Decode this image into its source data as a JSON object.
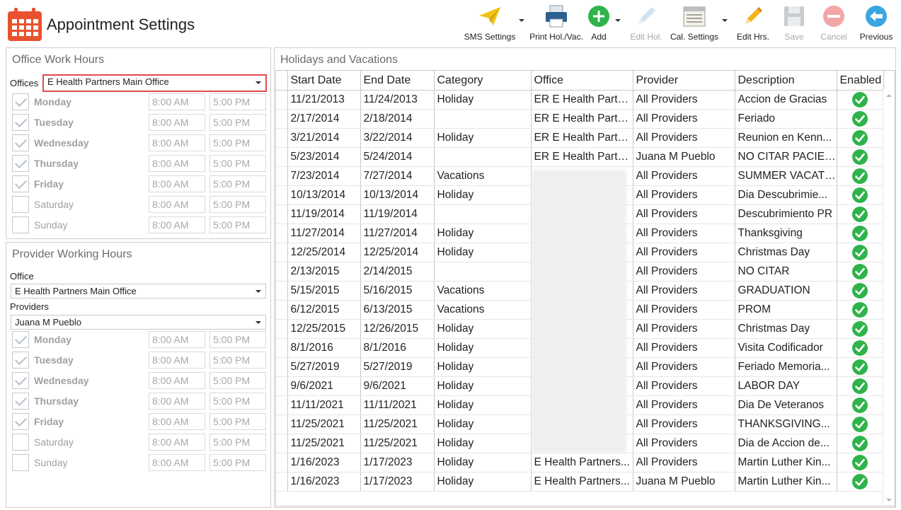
{
  "header": {
    "title": "Appointment Settings"
  },
  "toolbar": {
    "sms": "SMS Settings",
    "print": "Print Hol./Vac.",
    "add": "Add",
    "edit_hol": "Edit Hol.",
    "cal_settings": "Cal. Settings",
    "edit_hrs": "Edit Hrs.",
    "save": "Save",
    "cancel": "Cancel",
    "previous": "Previous"
  },
  "office_hours": {
    "title": "Office Work Hours",
    "offices_label": "Offices",
    "office_value": "E Health Partners Main Office",
    "days": [
      {
        "day": "Monday",
        "checked": true,
        "start": "8:00 AM",
        "end": "5:00 PM"
      },
      {
        "day": "Tuesday",
        "checked": true,
        "start": "8:00 AM",
        "end": "5:00 PM"
      },
      {
        "day": "Wednesday",
        "checked": true,
        "start": "8:00 AM",
        "end": "5:00 PM"
      },
      {
        "day": "Thursday",
        "checked": true,
        "start": "8:00 AM",
        "end": "5:00 PM"
      },
      {
        "day": "Friday",
        "checked": true,
        "start": "8:00 AM",
        "end": "5:00 PM"
      },
      {
        "day": "Saturday",
        "checked": false,
        "start": "8:00 AM",
        "end": "5:00 PM"
      },
      {
        "day": "Sunday",
        "checked": false,
        "start": "8:00 AM",
        "end": "5:00 PM"
      }
    ]
  },
  "provider_hours": {
    "title": "Provider Working Hours",
    "office_label": "Office",
    "office_value": "E Health Partners Main Office",
    "providers_label": "Providers",
    "provider_value": "Juana M Pueblo",
    "days": [
      {
        "day": "Monday",
        "checked": true,
        "start": "8:00 AM",
        "end": "5:00 PM"
      },
      {
        "day": "Tuesday",
        "checked": true,
        "start": "8:00 AM",
        "end": "5:00 PM"
      },
      {
        "day": "Wednesday",
        "checked": true,
        "start": "8:00 AM",
        "end": "5:00 PM"
      },
      {
        "day": "Thursday",
        "checked": true,
        "start": "8:00 AM",
        "end": "5:00 PM"
      },
      {
        "day": "Friday",
        "checked": true,
        "start": "8:00 AM",
        "end": "5:00 PM"
      },
      {
        "day": "Saturday",
        "checked": false,
        "start": "8:00 AM",
        "end": "5:00 PM"
      },
      {
        "day": "Sunday",
        "checked": false,
        "start": "8:00 AM",
        "end": "5:00 PM"
      }
    ]
  },
  "holidays": {
    "title": "Holidays and Vacations",
    "columns": [
      "Start Date",
      "End Date",
      "Category",
      "Office",
      "Provider",
      "Description",
      "Enabled"
    ],
    "rows": [
      [
        "11/21/2013",
        "11/24/2013",
        "Holiday",
        "ER E Health Partn...",
        "All Providers",
        "Accion de Gracias"
      ],
      [
        "2/17/2014",
        "2/18/2014",
        "",
        "ER E Health Partn...",
        "All Providers",
        "Feriado"
      ],
      [
        "3/21/2014",
        "3/22/2014",
        "Holiday",
        "ER E Health Partn...",
        "All Providers",
        "Reunion en Kenn..."
      ],
      [
        "5/23/2014",
        "5/24/2014",
        "",
        "ER E Health Partn...",
        "Juana M Pueblo",
        "NO CITAR PACIET..."
      ],
      [
        "7/23/2014",
        "7/27/2014",
        "Vacations",
        "",
        "All Providers",
        "SUMMER VACATI..."
      ],
      [
        "10/13/2014",
        "10/13/2014",
        "Holiday",
        "",
        "All Providers",
        "Dia Descubrimie..."
      ],
      [
        "11/19/2014",
        "11/19/2014",
        "",
        "",
        "All Providers",
        "Descubrimiento PR"
      ],
      [
        "11/27/2014",
        "11/27/2014",
        "Holiday",
        "",
        "All Providers",
        "Thanksgiving"
      ],
      [
        "12/25/2014",
        "12/25/2014",
        "Holiday",
        "",
        "All Providers",
        "Christmas Day"
      ],
      [
        "2/13/2015",
        "2/14/2015",
        "",
        "",
        "All Providers",
        "NO CITAR"
      ],
      [
        "5/15/2015",
        "5/16/2015",
        "Vacations",
        "",
        "All Providers",
        "GRADUATION"
      ],
      [
        "6/12/2015",
        "6/13/2015",
        "Vacations",
        "",
        "All Providers",
        "PROM"
      ],
      [
        "12/25/2015",
        "12/26/2015",
        "Holiday",
        "",
        "All Providers",
        "Christmas Day"
      ],
      [
        "8/1/2016",
        "8/1/2016",
        "Holiday",
        "",
        "All Providers",
        "Visita Codificador"
      ],
      [
        "5/27/2019",
        "5/27/2019",
        "Holiday",
        "",
        "All Providers",
        "Feriado Memoria..."
      ],
      [
        "9/6/2021",
        "9/6/2021",
        "Holiday",
        "",
        "All Providers",
        "LABOR DAY"
      ],
      [
        "11/11/2021",
        "11/11/2021",
        "Holiday",
        "",
        "All Providers",
        "Dia De Veteranos"
      ],
      [
        "11/25/2021",
        "11/25/2021",
        "Holiday",
        "",
        "All Providers",
        "THANKSGIVING..."
      ],
      [
        "11/25/2021",
        "11/25/2021",
        "Holiday",
        "",
        "All Providers",
        "Dia de Accion de..."
      ],
      [
        "1/16/2023",
        "1/17/2023",
        "Holiday",
        "E Health Partners...",
        "All Providers",
        "Martin Luther Kin..."
      ],
      [
        "1/16/2023",
        "1/17/2023",
        "Holiday",
        "E Health Partners...",
        "Juana M Pueblo",
        "Martin Luther Kin..."
      ]
    ]
  },
  "colors": {
    "accent_red": "#e8522f",
    "enabled_green": "#2fb34a",
    "highlight_border": "#e04b4b"
  }
}
